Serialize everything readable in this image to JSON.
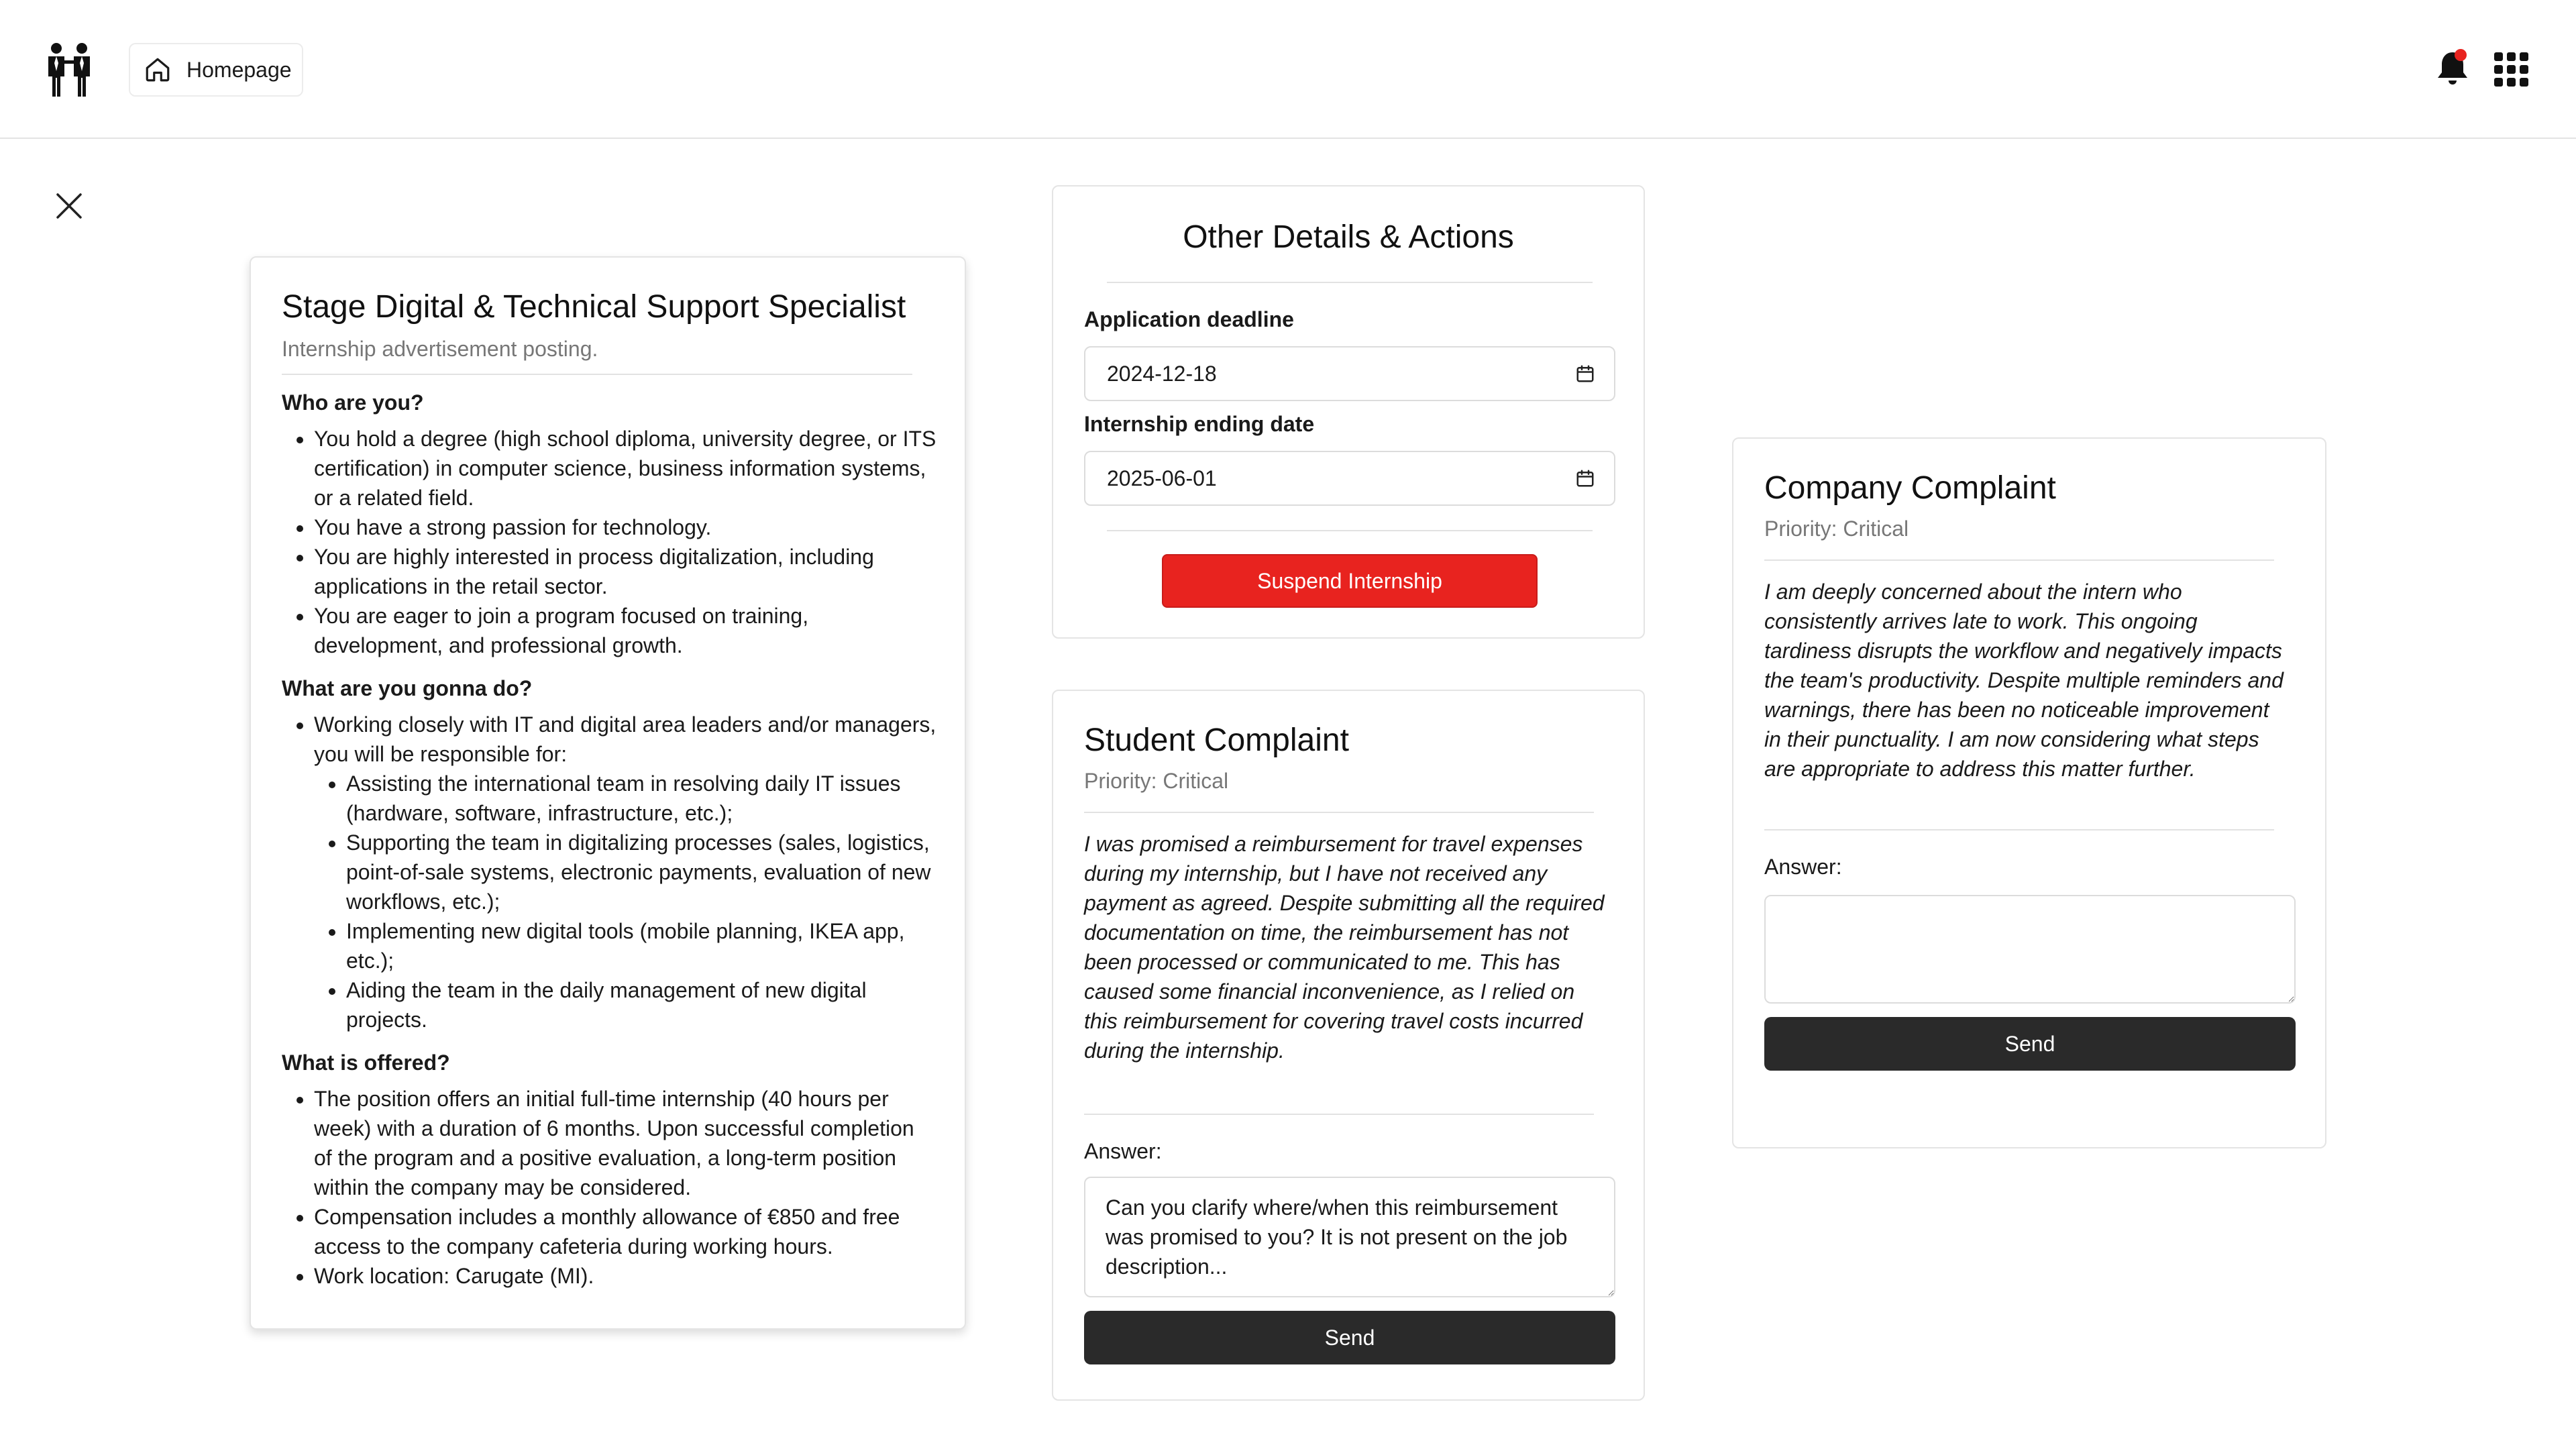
{
  "header": {
    "home_label": "Homepage"
  },
  "posting": {
    "title": "Stage Digital & Technical Support Specialist",
    "subtitle": "Internship advertisement posting.",
    "sections": [
      {
        "heading": "Who are you?",
        "items": [
          "You hold a degree (high school diploma, university degree, or ITS certification) in computer science, business information systems, or a related field.",
          "You have a strong passion for technology.",
          "You are highly interested in process digitalization, including applications in the retail sector.",
          "You are eager to join a program focused on training, development, and professional growth."
        ]
      },
      {
        "heading": "What are you gonna do?",
        "intro": "Working closely with IT and digital area leaders and/or managers, you will be responsible for:",
        "items": [
          "Assisting the international team in resolving daily IT issues (hardware, software, infrastructure, etc.);",
          "Supporting the team in digitalizing processes (sales, logistics, point-of-sale systems, electronic payments, evaluation of new workflows, etc.);",
          "Implementing new digital tools (mobile planning, IKEA app, etc.);",
          "Aiding the team in the daily management of new digital projects."
        ]
      },
      {
        "heading": "What is offered?",
        "items": [
          "The position offers an initial full-time internship (40 hours per week) with a duration of 6 months. Upon successful completion of the program and a positive evaluation, a long-term position within the company may be considered.",
          "Compensation includes a monthly allowance of €850 and free access to the company cafeteria during working hours.",
          "Work location: Carugate (MI)."
        ]
      }
    ]
  },
  "details": {
    "title": "Other Details & Actions",
    "deadline_label": "Application deadline",
    "deadline_value": "2024-12-18",
    "ending_label": "Internship ending date",
    "ending_value": "2025-06-01",
    "suspend_label": "Suspend Internship"
  },
  "student_complaint": {
    "title": "Student Complaint",
    "priority": "Priority: Critical",
    "text": "I was promised a reimbursement for travel expenses during my internship, but I have not received any payment as agreed. Despite submitting all the required documentation on time, the reimbursement has not been processed or communicated to me. This has caused some financial inconvenience, as I relied on this reimbursement for covering travel costs incurred during the internship.",
    "answer_label": "Answer:",
    "answer_value": "Can you clarify where/when this reimbursement was promised to you? It is not present on the job description...",
    "send_label": "Send"
  },
  "company_complaint": {
    "title": "Company Complaint",
    "priority": "Priority: Critical",
    "text": "I am deeply concerned about the intern who consistently arrives late to work. This ongoing tardiness disrupts the workflow and negatively impacts the team's productivity. Despite multiple reminders and warnings, there has been no noticeable improvement in their punctuality. I am now considering what steps are appropriate to address this matter further.",
    "answer_label": "Answer:",
    "answer_value": "",
    "send_label": "Send"
  },
  "colors": {
    "danger": "#e8231f",
    "dark_button": "#2a2a2a",
    "notification_dot": "#e8231f",
    "muted_text": "#777777"
  },
  "icons": [
    "logo-people-icon",
    "home-icon",
    "bell-icon",
    "apps-grid-icon",
    "close-icon",
    "calendar-icon"
  ]
}
